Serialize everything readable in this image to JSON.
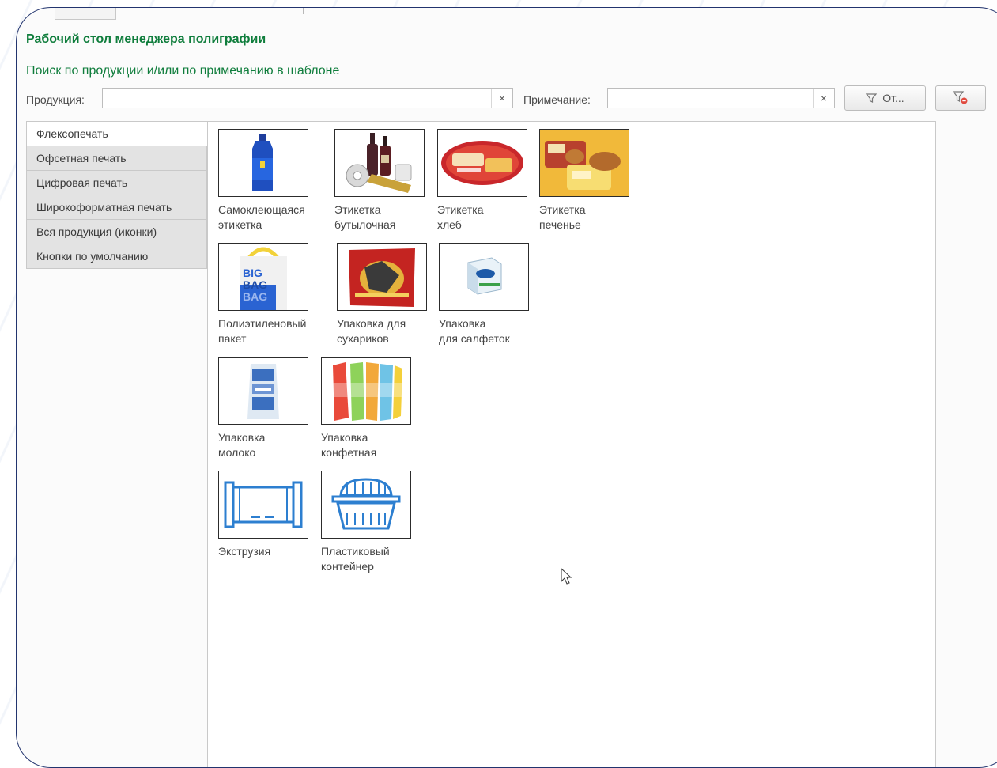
{
  "app": {
    "title": "Рабочий стол менеджера полиграфии",
    "search_header": "Поиск по продукции и/или по примечанию в шаблоне"
  },
  "search": {
    "product_label": "Продукция:",
    "product_value": "",
    "note_label": "Примечание:",
    "note_value": "",
    "clear_symbol": "×",
    "filter_button_label": "От..."
  },
  "tabs": [
    {
      "label": "Флексопечать",
      "active": true
    },
    {
      "label": "Офсетная печать"
    },
    {
      "label": "Цифровая печать"
    },
    {
      "label": "Широкоформатная печать"
    },
    {
      "label": "Вся продукция (иконки)"
    },
    {
      "label": "Кнопки по умолчанию"
    }
  ],
  "products": [
    {
      "caption": "Самоклеющаяся\nэтикетка",
      "icon": "bottle-label-icon"
    },
    {
      "caption": "Этикетка\nбутылочная",
      "icon": "wine-bottles-icon"
    },
    {
      "caption": "Этикетка\nхлеб",
      "icon": "bread-label-icon"
    },
    {
      "caption": "Этикетка\nпеченье",
      "icon": "cookie-pack-icon"
    },
    {
      "caption": "Полиэтиленовый\nпакет",
      "icon": "plastic-bag-icon",
      "image_text": "BIG\nBAG\nBAG"
    },
    {
      "caption": "Упаковка для\nсухариков",
      "icon": "crackers-pack-icon"
    },
    {
      "caption": "Упаковка\nдля салфеток",
      "icon": "napkins-pack-icon"
    },
    {
      "caption": "Упаковка\nмолоко",
      "icon": "milk-pack-icon"
    },
    {
      "caption": "Упаковка\nконфетная",
      "icon": "candy-wrap-icon"
    },
    {
      "caption": "Экструзия",
      "icon": "extrusion-icon"
    },
    {
      "caption": "Пластиковый\nконтейнер",
      "icon": "container-icon"
    }
  ]
}
